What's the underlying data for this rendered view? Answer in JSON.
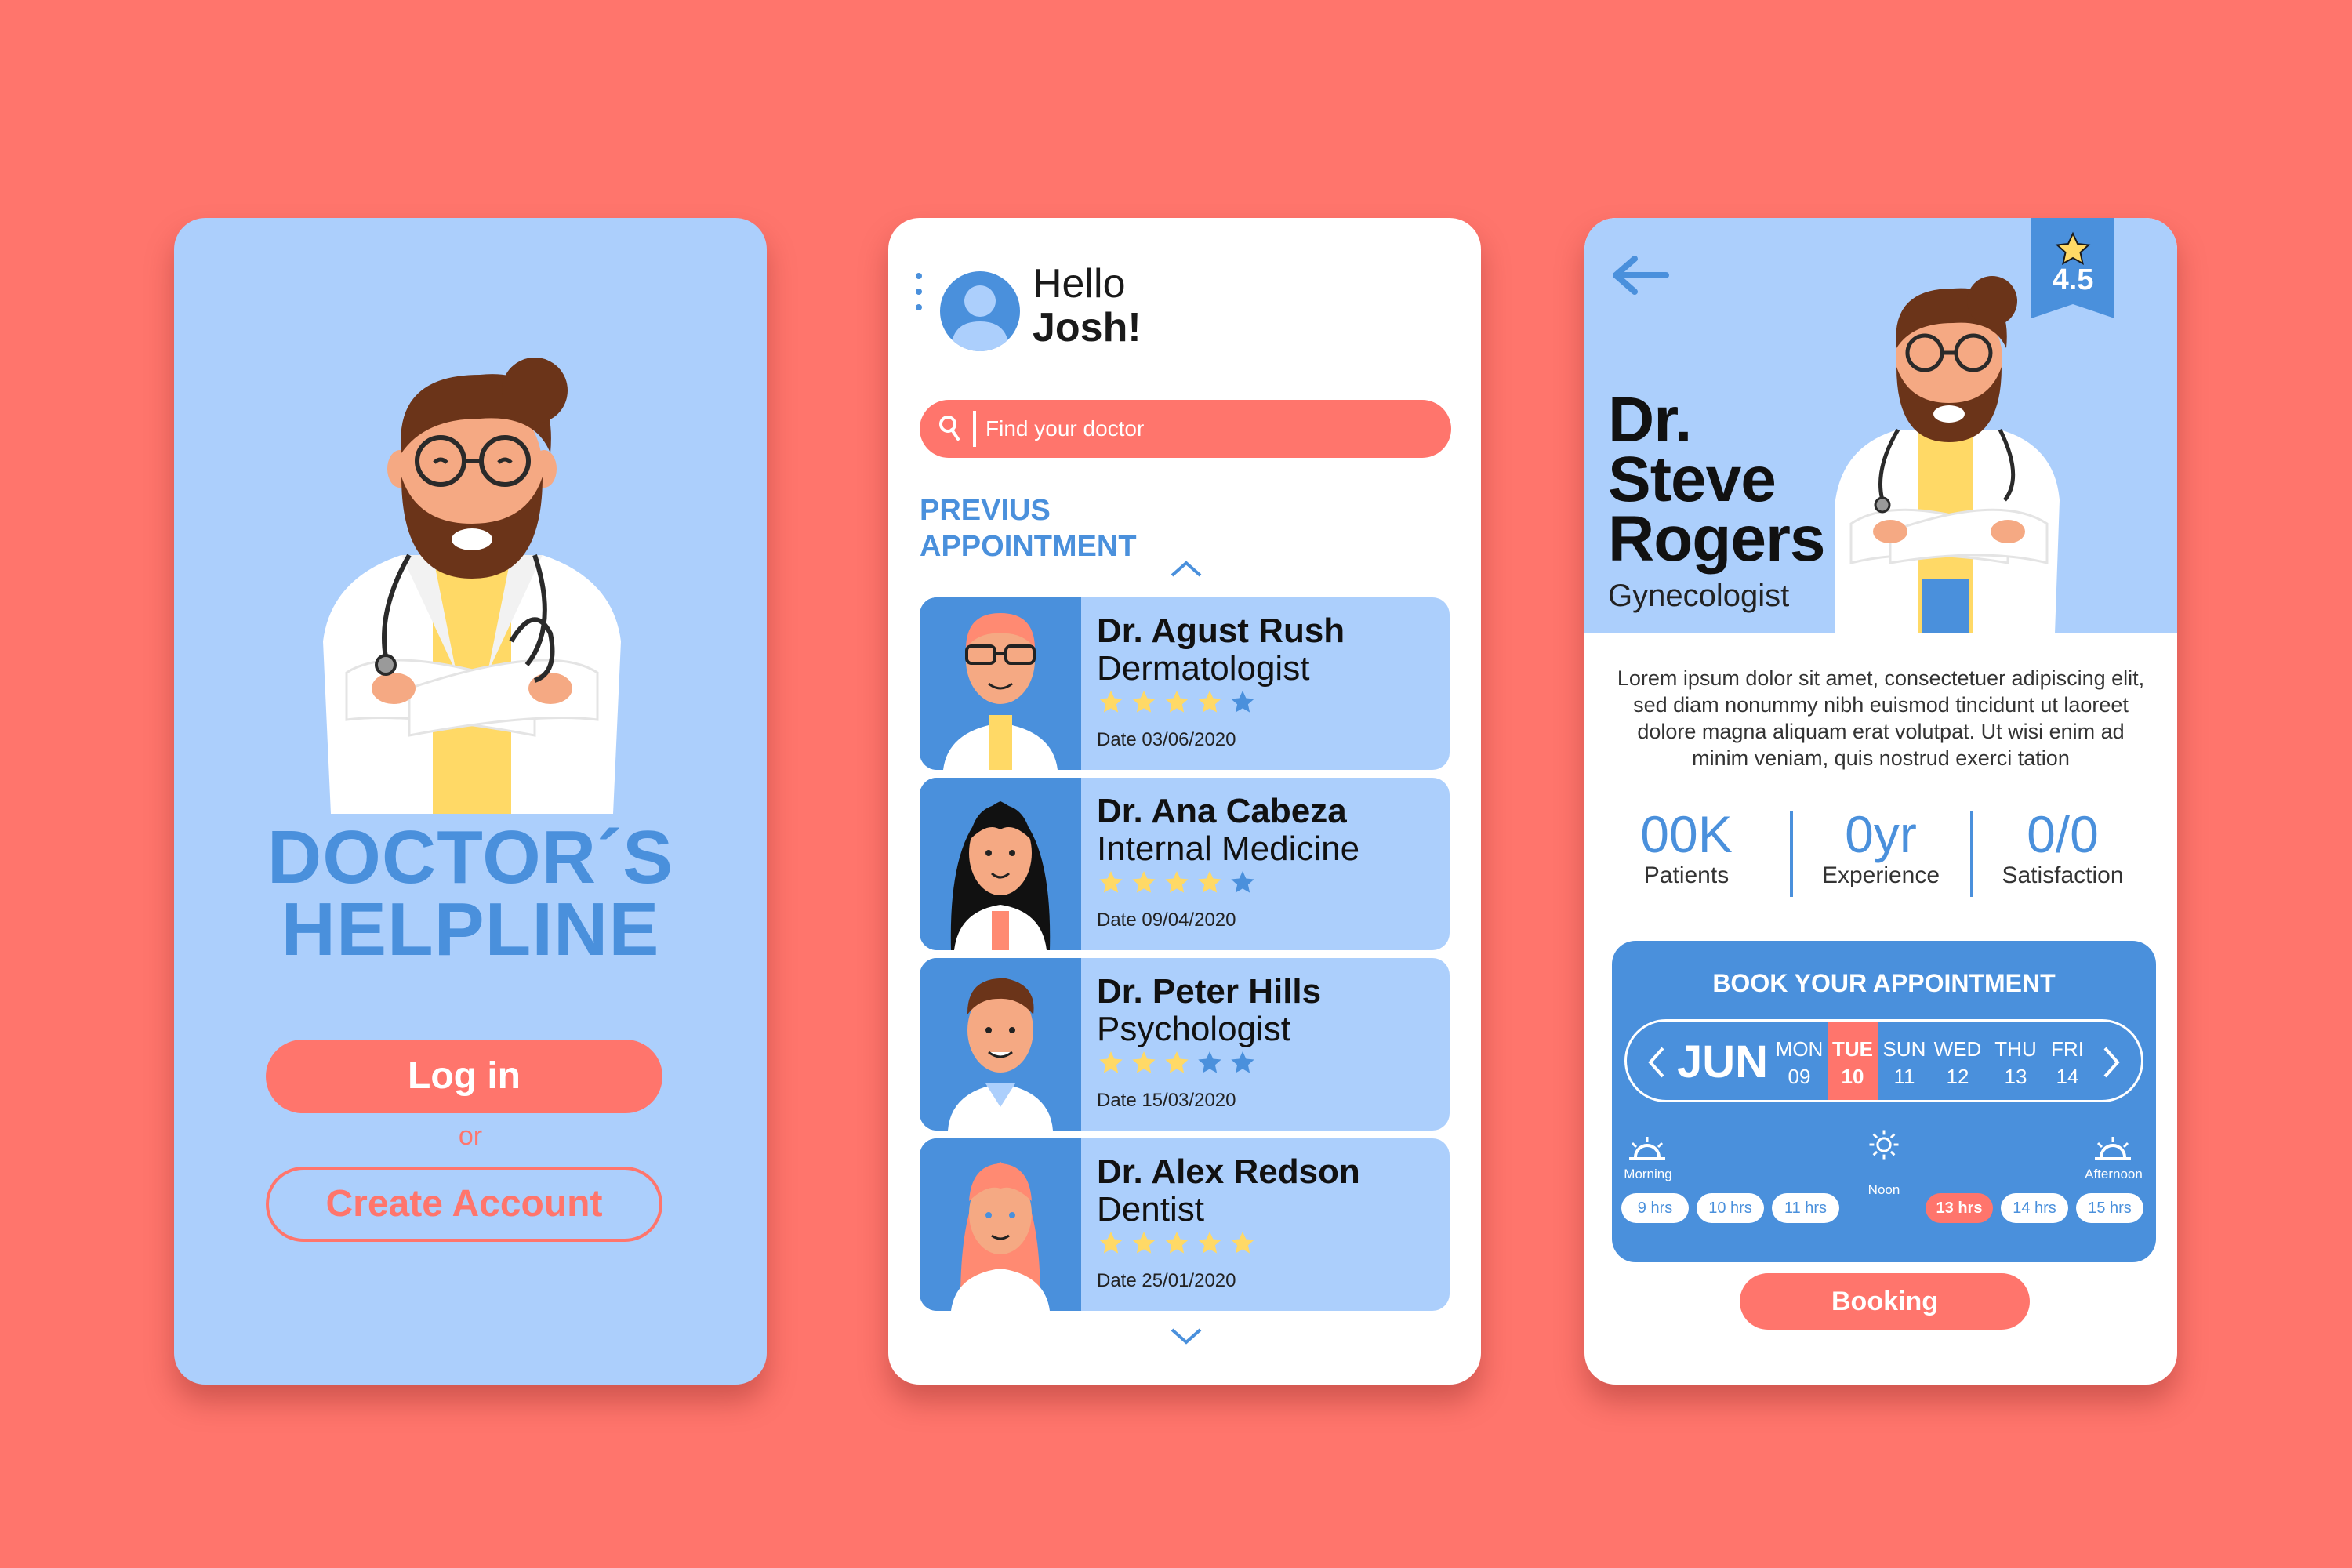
{
  "colors": {
    "background": "#FF756C",
    "accent_blue": "#4A90DC",
    "light_blue": "#ACCFFC",
    "coral": "#FF756C",
    "star_yellow": "#FFD966"
  },
  "login": {
    "brand_line1": "DOCTOR´S",
    "brand_line2": "HELPLINE",
    "login_label": "Log in",
    "or_text": "or",
    "create_label": "Create Account"
  },
  "home": {
    "greeting": "Hello",
    "user_name": "Josh!",
    "search_placeholder": "Find your doctor",
    "section_title_line1": "PREVIUS",
    "section_title_line2": "APPOINTMENT",
    "appointments": [
      {
        "name": "Dr. Agust Rush",
        "specialty": "Dermatologist",
        "rating": 4,
        "date": "Date 03/06/2020"
      },
      {
        "name": "Dr. Ana Cabeza",
        "specialty": "Internal Medicine",
        "rating": 4,
        "date": "Date 09/04/2020"
      },
      {
        "name": "Dr. Peter  Hills",
        "specialty": "Psychologist",
        "rating": 3,
        "date": "Date 15/03/2020"
      },
      {
        "name": "Dr. Alex Redson",
        "specialty": "Dentist",
        "rating": 5,
        "date": "Date 25/01/2020"
      }
    ]
  },
  "detail": {
    "rating": "4.5",
    "name_line1": "Dr.",
    "name_line2": "Steve",
    "name_line3": "Rogers",
    "specialty": "Gynecologist",
    "description": "Lorem ipsum dolor sit amet, consectetuer adipiscing elit, sed diam nonummy nibh euismod tincidunt ut laoreet dolore magna aliquam erat volutpat. Ut wisi enim ad minim veniam, quis nostrud exerci tation",
    "stats": [
      {
        "value": "00K",
        "label": "Patients"
      },
      {
        "value": "0yr",
        "label": "Experience"
      },
      {
        "value": "0/0",
        "label": "Satisfaction"
      }
    ],
    "booking": {
      "title": "BOOK YOUR APPOINTMENT",
      "month": "JUN",
      "days": [
        {
          "name": "MON",
          "date": "09",
          "selected": false
        },
        {
          "name": "TUE",
          "date": "10",
          "selected": true
        },
        {
          "name": "SUN",
          "date": "11",
          "selected": false
        },
        {
          "name": "WED",
          "date": "12",
          "selected": false
        },
        {
          "name": "THU",
          "date": "13",
          "selected": false
        },
        {
          "name": "FRI",
          "date": "14",
          "selected": false
        }
      ],
      "periods": {
        "morning": "Morning",
        "noon": "Noon",
        "afternoon": "Afternoon"
      },
      "slots": [
        {
          "label": "9 hrs",
          "selected": false
        },
        {
          "label": "10 hrs",
          "selected": false
        },
        {
          "label": "11 hrs",
          "selected": false
        },
        {
          "label": "13 hrs",
          "selected": true
        },
        {
          "label": "14 hrs",
          "selected": false
        },
        {
          "label": "15 hrs",
          "selected": false
        }
      ],
      "button_label": "Booking"
    }
  }
}
